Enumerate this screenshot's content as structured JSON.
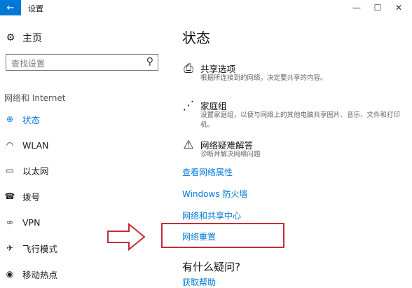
{
  "window": {
    "back_icon": "back-arrow-icon",
    "title": "设置",
    "controls": [
      "minimize-icon",
      "maximize-icon",
      "close-icon"
    ]
  },
  "sidebar": {
    "home_label": "主页",
    "search_placeholder": "查找设置",
    "section_title": "网络和 Internet",
    "items": [
      {
        "label": "状态",
        "icon": "status-globe-icon",
        "active": true
      },
      {
        "label": "WLAN",
        "icon": "wifi-icon",
        "active": false
      },
      {
        "label": "以太网",
        "icon": "ethernet-icon",
        "active": false
      },
      {
        "label": "拨号",
        "icon": "dialup-icon",
        "active": false
      },
      {
        "label": "VPN",
        "icon": "vpn-icon",
        "active": false
      },
      {
        "label": "飞行模式",
        "icon": "airplane-icon",
        "active": false
      },
      {
        "label": "移动热点",
        "icon": "hotspot-icon",
        "active": false
      }
    ]
  },
  "main": {
    "title": "状态",
    "options": [
      {
        "title": "共享选项",
        "desc": "根据所连接到的网络，决定要共享的内容。",
        "icon": "sharing-printer-icon"
      },
      {
        "title": "家庭组",
        "desc": "设置家庭组，以便与网络上的其他电脑共享图片、音乐、文件和打印机。",
        "icon": "homegroup-icon"
      },
      {
        "title": "网络疑难解答",
        "desc": "诊断并解决网络问题",
        "icon": "warning-icon"
      }
    ],
    "links": [
      "查看网络属性",
      "Windows 防火墙",
      "网络和共享中心",
      "网络重置"
    ],
    "help_title": "有什么疑问?",
    "help_link": "获取帮助"
  },
  "colors": {
    "accent": "#0078d7",
    "highlight_border": "#c42b36"
  }
}
